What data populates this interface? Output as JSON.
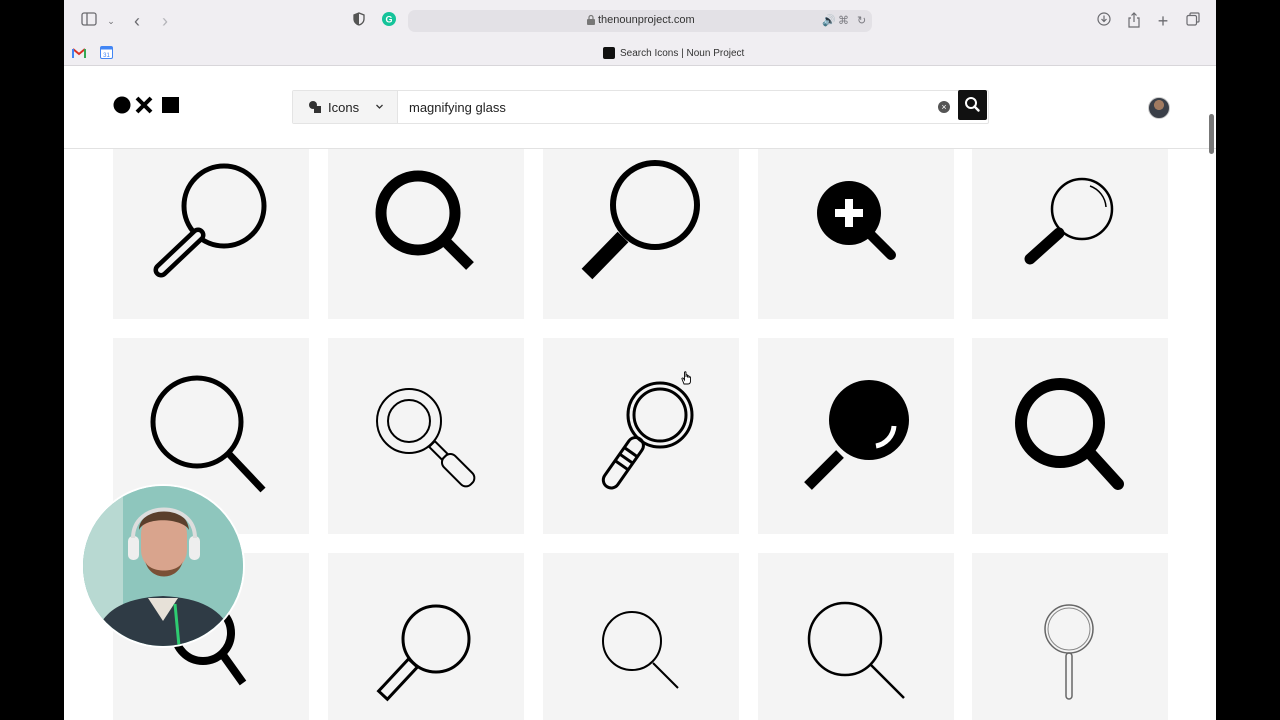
{
  "browser": {
    "url": "thenounproject.com",
    "tab_title": "Search Icons | Noun Project"
  },
  "header": {
    "search": {
      "category": "Icons",
      "query": "magnifying glass"
    }
  },
  "results": [
    {
      "icon": "magnifying-glass-outline-tilted-icon"
    },
    {
      "icon": "magnifying-glass-bold-icon"
    },
    {
      "icon": "magnifying-glass-thick-handle-icon"
    },
    {
      "icon": "zoom-in-plus-icon"
    },
    {
      "icon": "magnifying-glass-lens-highlight-icon"
    },
    {
      "icon": "magnifying-glass-large-outline-icon"
    },
    {
      "icon": "magnifying-glass-double-ring-icon"
    },
    {
      "icon": "magnifying-glass-striped-handle-icon"
    },
    {
      "icon": "magnifying-glass-solid-lens-icon"
    },
    {
      "icon": "magnifying-glass-heavy-icon"
    },
    {
      "icon": "magnifying-glass-partial-icon"
    },
    {
      "icon": "magnifying-glass-outline-handle-icon"
    },
    {
      "icon": "magnifying-glass-thin-icon"
    },
    {
      "icon": "magnifying-glass-thin-large-icon"
    },
    {
      "icon": "magnifying-glass-vertical-thin-icon"
    }
  ],
  "colors": {
    "tile_bg": "#f4f4f4",
    "icon": "#000000",
    "accent": "#111111"
  }
}
